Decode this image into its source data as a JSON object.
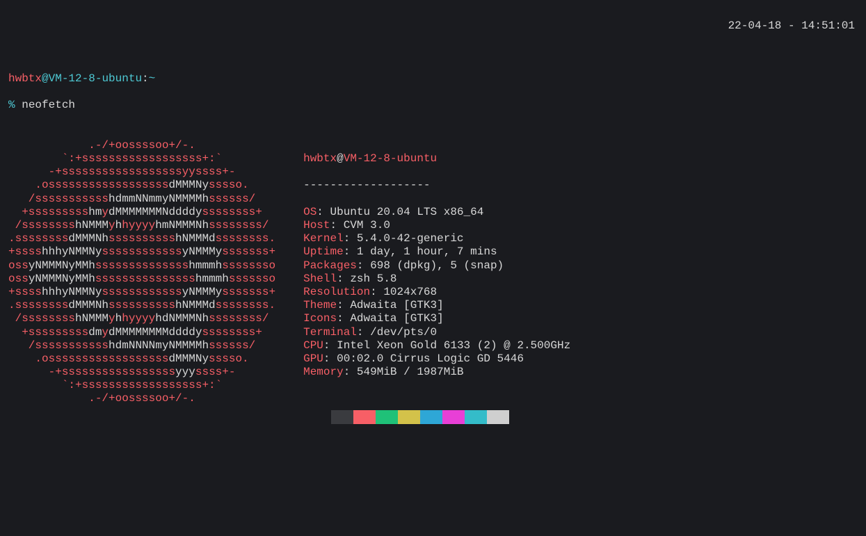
{
  "prompt": {
    "user": "hwbtx",
    "at": "@",
    "host": "VM-12-8-ubuntu",
    "colon": ":",
    "path": "~",
    "symbol": "%",
    "command": "neofetch"
  },
  "timestamp": "22-04-18 - 14:51:01",
  "logo": [
    {
      "pre": "            .-/+oossssoo+/-.",
      "w": ""
    },
    {
      "pre": "        `:+ssssssssssssssssss+:`",
      "w": ""
    },
    {
      "pre": "      -+ssssssssssssssssssyyssss+-",
      "w": ""
    },
    {
      "pre": "    .ossssssssssssssssss",
      "w": "dMMMNy",
      "post": "sssso."
    },
    {
      "pre": "   /sssssssssss",
      "w": "hdmmNNmmyNMMMMh",
      "post": "ssssss/"
    },
    {
      "pre": "  +sssssssss",
      "w": "hm",
      "post": "y",
      "w2": "dMMMMMMMNddddy",
      "post2": "ssssssss+"
    },
    {
      "pre": " /ssssssss",
      "w": "hNMMM",
      "post": "y",
      "w2": "h",
      "post2": "hyyyy",
      "w3": "hmNMMMNh",
      "post3": "ssssssss/"
    },
    {
      "pre": ".ssssssss",
      "w": "dMMMNh",
      "post": "ssssssssss",
      "w2": "hNMMMd",
      "post2": "ssssssss."
    },
    {
      "pre": "+ssss",
      "w": "hhhyNMMNy",
      "post": "ssssssssssss",
      "w2": "yNMMMy",
      "post2": "sssssss+"
    },
    {
      "pre": "oss",
      "w": "yNMMMNyMMh",
      "post": "ssssssssssssss",
      "w2": "hmmmh",
      "post2": "ssssssso"
    },
    {
      "pre": "oss",
      "w": "yNMMMNyMMh",
      "post": "sssssssssssssss",
      "w2": "hmmmh",
      "post2": "sssssso"
    },
    {
      "pre": "+ssss",
      "w": "hhhyNMMNy",
      "post": "ssssssssssss",
      "w2": "yNMMMy",
      "post2": "sssssss+"
    },
    {
      "pre": ".ssssssss",
      "w": "dMMMNh",
      "post": "ssssssssss",
      "w2": "hNMMMd",
      "post2": "ssssssss."
    },
    {
      "pre": " /ssssssss",
      "w": "hNMMM",
      "post": "y",
      "w2": "h",
      "post2": "hyyyy",
      "w3": "hdNMMMNh",
      "post3": "ssssssss/"
    },
    {
      "pre": "  +sssssssss",
      "w": "dm",
      "post": "y",
      "w2": "dMMMMMMMMddddy",
      "post2": "ssssssss+"
    },
    {
      "pre": "   /sssssssssss",
      "w": "hdmNNNNmyNMMMMh",
      "post": "ssssss/"
    },
    {
      "pre": "    .ossssssssssssssssss",
      "w": "dMMMNy",
      "post": "sssso."
    },
    {
      "pre": "      -+sssssssssssssssss",
      "w": "yyy",
      "post": "ssss+-"
    },
    {
      "pre": "        `:+ssssssssssssssssss+:`",
      "w": ""
    },
    {
      "pre": "            .-/+oossssoo+/-.",
      "w": ""
    }
  ],
  "header": {
    "user": "hwbtx",
    "at": "@",
    "host": "VM-12-8-ubuntu",
    "sep": "-------------------"
  },
  "info": [
    {
      "label": "OS",
      "value": "Ubuntu 20.04 LTS x86_64"
    },
    {
      "label": "Host",
      "value": "CVM 3.0"
    },
    {
      "label": "Kernel",
      "value": "5.4.0-42-generic"
    },
    {
      "label": "Uptime",
      "value": "1 day, 1 hour, 7 mins"
    },
    {
      "label": "Packages",
      "value": "698 (dpkg), 5 (snap)"
    },
    {
      "label": "Shell",
      "value": "zsh 5.8"
    },
    {
      "label": "Resolution",
      "value": "1024x768"
    },
    {
      "label": "Theme",
      "value": "Adwaita [GTK3]"
    },
    {
      "label": "Icons",
      "value": "Adwaita [GTK3]"
    },
    {
      "label": "Terminal",
      "value": "/dev/pts/0"
    },
    {
      "label": "CPU",
      "value": "Intel Xeon Gold 6133 (2) @ 2.500GHz"
    },
    {
      "label": "GPU",
      "value": "00:02.0 Cirrus Logic GD 5446"
    },
    {
      "label": "Memory",
      "value": "549MiB / 1987MiB"
    }
  ]
}
